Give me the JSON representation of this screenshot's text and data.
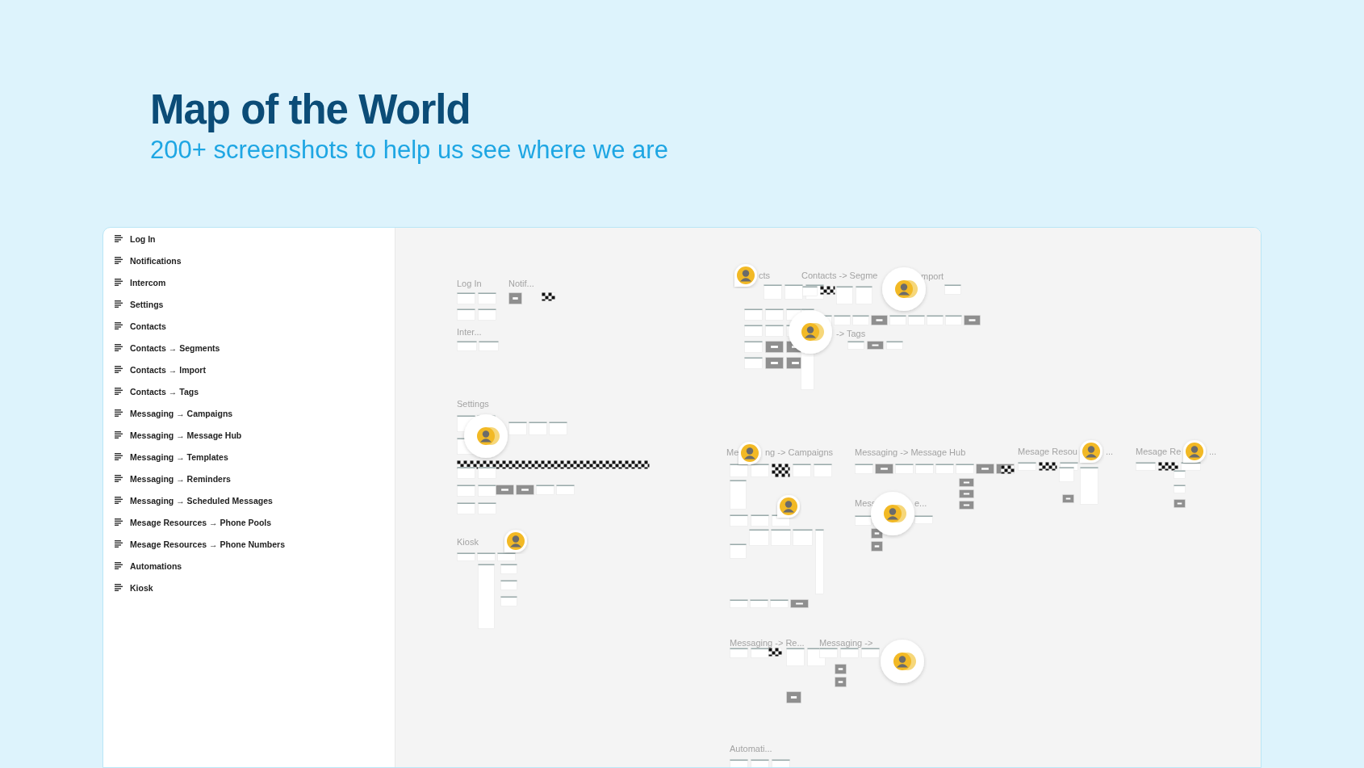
{
  "header": {
    "title": "Map of the World",
    "subtitle": "200+ screenshots to help us see where we are"
  },
  "sidebar": {
    "items": [
      {
        "label": "Log In"
      },
      {
        "label": "Notifications"
      },
      {
        "label": "Intercom"
      },
      {
        "label": "Settings"
      },
      {
        "label": "Contacts"
      },
      {
        "label": "Contacts → Segments"
      },
      {
        "label": "Contacts → Import"
      },
      {
        "label": "Contacts → Tags"
      },
      {
        "label": "Messaging → Campaigns"
      },
      {
        "label": "Messaging → Message Hub"
      },
      {
        "label": "Messaging → Templates"
      },
      {
        "label": "Messaging → Reminders"
      },
      {
        "label": "Messaging → Scheduled Messages"
      },
      {
        "label": "Mesage Resources → Phone Pools"
      },
      {
        "label": "Mesage Resources → Phone Numbers"
      },
      {
        "label": "Automations"
      },
      {
        "label": "Kiosk"
      }
    ]
  },
  "canvas": {
    "frame_labels": [
      {
        "label": "Log In"
      },
      {
        "label": "Notif..."
      },
      {
        "label": "Inter..."
      },
      {
        "label": "Settings"
      },
      {
        "label": "Kiosk"
      },
      {
        "label": "cts"
      },
      {
        "label": "Contacts -> Segme"
      },
      {
        "label": "mport"
      },
      {
        "label": "-> Tags"
      },
      {
        "label": "Me"
      },
      {
        "label": "ng -> Campaigns"
      },
      {
        "label": "Messaging -> Message Hub"
      },
      {
        "label": "Mess"
      },
      {
        "label": "e..."
      },
      {
        "label": "Mesage Resou"
      },
      {
        "label": "..."
      },
      {
        "label": "Mesage Re"
      },
      {
        "label": "..."
      },
      {
        "label": "Messaging -> Re..."
      },
      {
        "label": "Messaging ->"
      },
      {
        "label": "Automati..."
      }
    ],
    "avatars": [
      {
        "kind": "pin"
      },
      {
        "kind": "bubble"
      },
      {
        "kind": "bubble"
      },
      {
        "kind": "bubble"
      },
      {
        "kind": "pin"
      },
      {
        "kind": "pin"
      },
      {
        "kind": "pin"
      },
      {
        "kind": "bubble"
      },
      {
        "kind": "pin"
      },
      {
        "kind": "pin"
      },
      {
        "kind": "bubble"
      }
    ]
  }
}
